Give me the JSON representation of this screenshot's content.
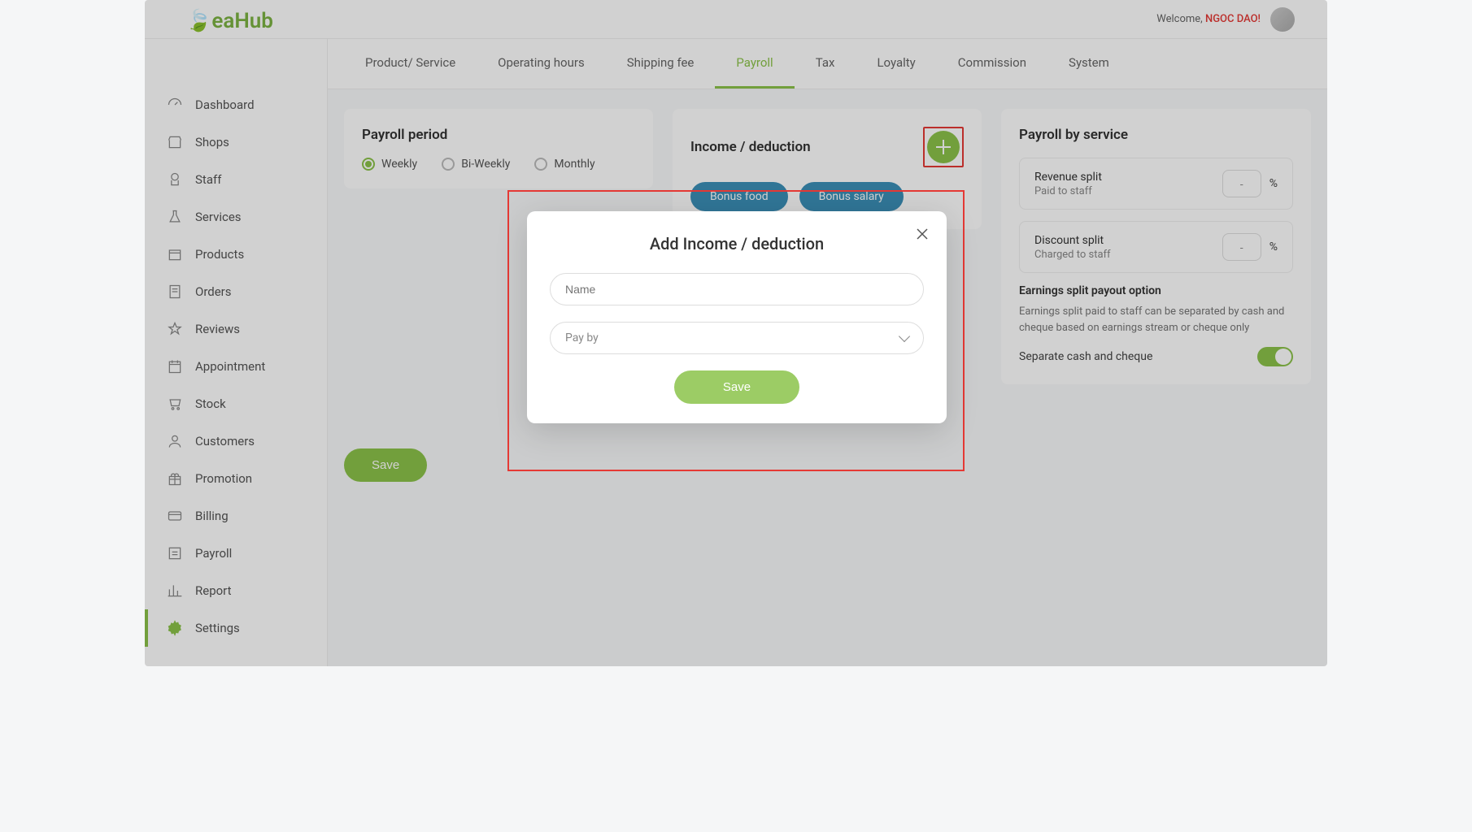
{
  "brand": "eaHub",
  "header": {
    "welcome_prefix": "Welcome, ",
    "username": "NGOC DAO!"
  },
  "sidebar": {
    "items": [
      {
        "label": "Dashboard",
        "icon": "gauge"
      },
      {
        "label": "Shops",
        "icon": "store"
      },
      {
        "label": "Staff",
        "icon": "chef"
      },
      {
        "label": "Services",
        "icon": "flask"
      },
      {
        "label": "Products",
        "icon": "box"
      },
      {
        "label": "Orders",
        "icon": "receipt"
      },
      {
        "label": "Reviews",
        "icon": "star"
      },
      {
        "label": "Appointment",
        "icon": "calendar"
      },
      {
        "label": "Stock",
        "icon": "cart"
      },
      {
        "label": "Customers",
        "icon": "user"
      },
      {
        "label": "Promotion",
        "icon": "gift"
      },
      {
        "label": "Billing",
        "icon": "card"
      },
      {
        "label": "Payroll",
        "icon": "payroll"
      },
      {
        "label": "Report",
        "icon": "chart"
      },
      {
        "label": "Settings",
        "icon": "gear"
      }
    ],
    "active_index": 14
  },
  "tabs": {
    "items": [
      "Product/ Service",
      "Operating hours",
      "Shipping fee",
      "Payroll",
      "Tax",
      "Loyalty",
      "Commission",
      "System"
    ],
    "active_index": 3
  },
  "payroll_period": {
    "title": "Payroll period",
    "options": [
      "Weekly",
      "Bi-Weekly",
      "Monthly"
    ],
    "selected_index": 0
  },
  "income": {
    "title": "Income / deduction",
    "pills": [
      "Bonus food",
      "Bonus salary"
    ]
  },
  "payroll_service": {
    "title": "Payroll by service",
    "revenue_split": {
      "label": "Revenue split",
      "sub": "Paid to staff",
      "value": "-",
      "suffix": "%"
    },
    "discount_split": {
      "label": "Discount split",
      "sub": "Charged to staff",
      "value": "-",
      "suffix": "%"
    },
    "earnings_option_title": "Earnings split payout option",
    "earnings_info": "Earnings split paid to staff can be separated by cash and cheque based on earnings stream or cheque only",
    "toggle_label": "Separate cash and cheque",
    "toggle_on": true
  },
  "save_label": "Save",
  "modal": {
    "title": "Add Income / deduction",
    "name_placeholder": "Name",
    "payby_label": "Pay by",
    "save_label": "Save"
  },
  "colors": {
    "accent": "#8BC34A",
    "danger": "#E53935",
    "pill": "#3B8FB8"
  }
}
